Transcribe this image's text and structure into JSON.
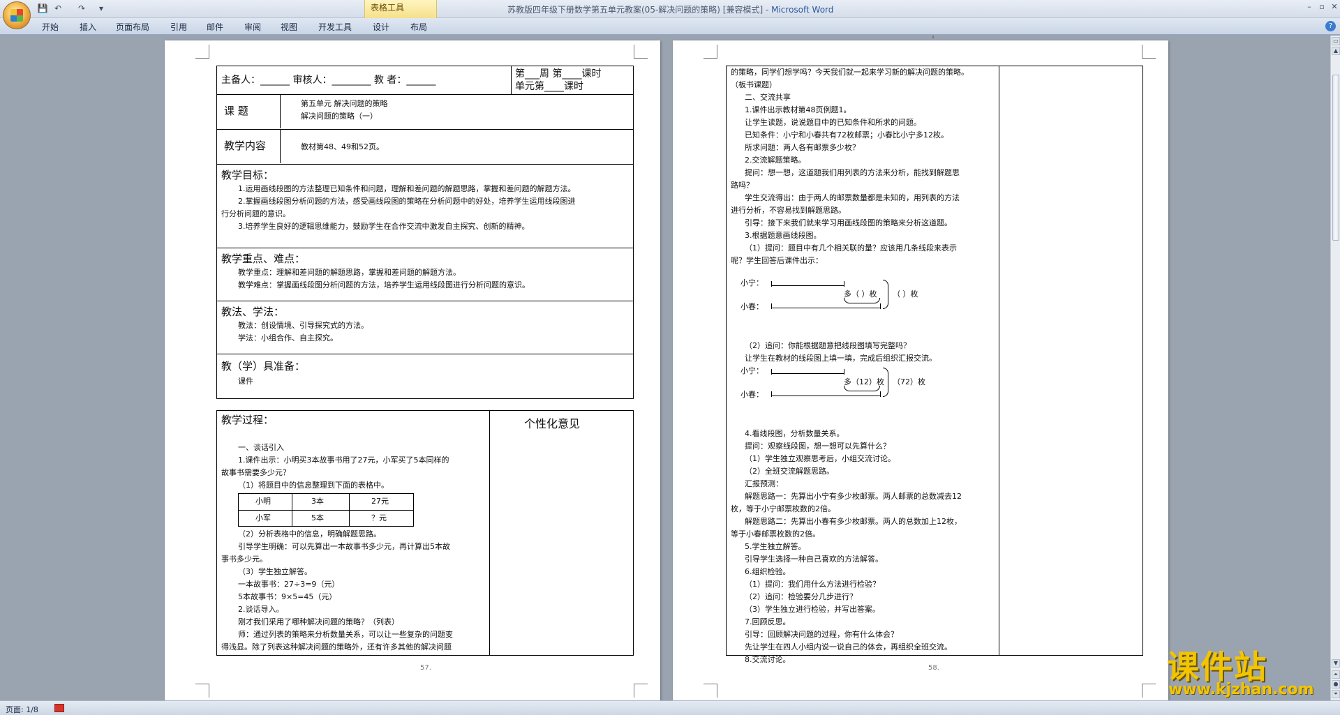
{
  "window": {
    "title": "苏教版四年级下册数学第五单元教案(05-解决问题的策略) [兼容模式] - ",
    "app_name": "Microsoft Word",
    "context_tab_group": "表格工具",
    "controls": {
      "minimize": "–",
      "restore": "▫",
      "close": "✕"
    }
  },
  "quick_access": {
    "save": "💾",
    "undo": "↶",
    "redo": "↷",
    "customize": "▾"
  },
  "ribbon": {
    "tabs": [
      "开始",
      "插入",
      "页面布局",
      "引用",
      "邮件",
      "审阅",
      "视图",
      "开发工具",
      "设计",
      "布局"
    ],
    "help": "?"
  },
  "status": {
    "page": "页面: 1/8"
  },
  "watermark": {
    "main": "课件站",
    "url": "www.kjzhan.com"
  },
  "left_page": {
    "page_number": "57.",
    "header": {
      "prep": "主备人：______  审核人：________  教    者：______",
      "week": "第___周  第____课时",
      "unit": "单元第____课时"
    },
    "topic_label": "课      题",
    "topic_lines": [
      "第五单元   解决问题的策略",
      "解决问题的策略（一）"
    ],
    "content_label": "教学内容",
    "content_text": "教材第48、49和52页。",
    "goals_title": "教学目标：",
    "goals_lines": [
      "1.运用画线段图的方法整理已知条件和问题，理解和差问题的解题思路，掌握和差问题的解题方法。",
      "2.掌握画线段图分析问题的方法，感受画线段图的策略在分析问题中的好处，培养学生运用线段图进",
      "行分析问题的意识。",
      "3.培养学生良好的逻辑思维能力，鼓励学生在合作交流中激发自主探究、创新的精神。"
    ],
    "key_title": "教学重点、难点：",
    "key_lines": [
      "教学重点：理解和差问题的解题思路，掌握和差问题的解题方法。",
      "教学难点：掌握画线段图分析问题的方法，培养学生运用线段图进行分析问题的意识。"
    ],
    "method_title": "教法、学法：",
    "method_lines": [
      "教法：创设情境、引导探究式的方法。",
      "学法：小组合作、自主探究。"
    ],
    "prep_title": "教（学）具准备：",
    "prep_text": "课件",
    "process_title": "教学过程：",
    "opinion_title": "个性化意见",
    "process_lines": [
      "一、谈话引入",
      "1.课件出示：小明买3本故事书用了27元，小军买了5本同样的",
      "故事书需要多少元？",
      "（1）将题目中的信息整理到下面的表格中。"
    ],
    "mini_table": [
      [
        "小明",
        "3本",
        "27元"
      ],
      [
        "小军",
        "5本",
        "？元"
      ]
    ],
    "process_lines2": [
      "（2）分析表格中的信息，明确解题思路。",
      "引导学生明确：可以先算出一本故事书多少元，再计算出5本故",
      "事书多少元。",
      "（3）学生独立解答。",
      "一本故事书：27÷3=9（元）",
      "5本故事书：9×5=45（元）",
      "2.谈话导入。",
      "刚才我们采用了哪种解决问题的策略？（列表）",
      "师：通过列表的策略来分析数量关系，可以让一些复杂的问题变",
      "得浅显。除了列表这种解决问题的策略外，还有许多其他的解决问题"
    ]
  },
  "right_page": {
    "page_number": "58.",
    "lines_a": [
      "的策略，同学们想学吗？今天我们就一起来学习新的解决问题的策略。",
      "（板书课题）",
      "二、交流共享",
      "1.课件出示教材第48页例题1。",
      "让学生读题，说说题目中的已知条件和所求的问题。",
      "已知条件：小宁和小春共有72枚邮票；小春比小宁多12枚。",
      "所求问题：两人各有邮票多少枚？",
      "2.交流解题策略。",
      "提问：想一想，这道题我们用列表的方法来分析，能找到解题思",
      "路吗？",
      "学生交流得出：由于两人的邮票数量都是未知的，用列表的方法",
      "进行分析，不容易找到解题思路。",
      "引导：接下来我们就来学习用画线段图的策略来分析这道题。",
      "3.根据题意画线段图。",
      "（1）提问：题目中有几个相关联的量？应该用几条线段来表示",
      "呢？学生回答后课件出示："
    ],
    "diagram1": {
      "label_a": "小宁：",
      "label_b": "小春：",
      "more": "多（  ）枚",
      "total": "（  ）枚"
    },
    "lines_b": [
      "（2）追问：你能根据题意把线段图填写完整吗？",
      "让学生在教材的线段图上填一填，完成后组织汇报交流。"
    ],
    "diagram2": {
      "label_a": "小宁：",
      "label_b": "小春：",
      "more": "多（12）枚",
      "total": "（72）枚"
    },
    "lines_c": [
      "4.看线段图，分析数量关系。",
      "提问：观察线段图，想一想可以先算什么？",
      "（1）学生独立观察思考后，小组交流讨论。",
      "（2）全班交流解题思路。",
      "汇报预测：",
      "解题思路一：先算出小宁有多少枚邮票。两人邮票的总数减去12",
      "枚，等于小宁邮票枚数的2倍。",
      "解题思路二：先算出小春有多少枚邮票。两人的总数加上12枚，",
      "等于小春邮票枚数的2倍。",
      "5.学生独立解答。",
      "引导学生选择一种自己喜欢的方法解答。",
      "6.组织检验。",
      "（1）提问：我们用什么方法进行检验？",
      "（2）追问：检验要分几步进行？",
      "（3）学生独立进行检验，并写出答案。",
      "7.回顾反思。",
      "引导：回顾解决问题的过程，你有什么体会？",
      "先让学生在四人小组内说一说自己的体会，再组织全班交流。",
      "8.交流讨论。"
    ]
  }
}
